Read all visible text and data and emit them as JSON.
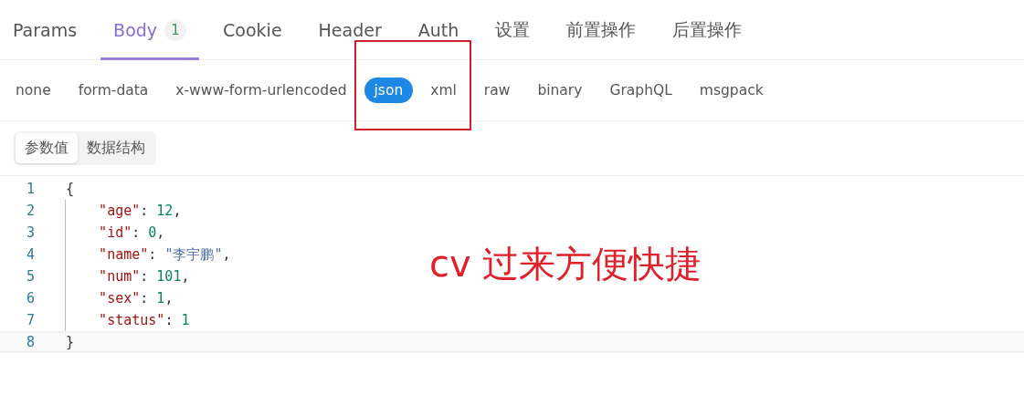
{
  "tabs": [
    {
      "label": "Params",
      "selected": false
    },
    {
      "label": "Body",
      "selected": true,
      "badge": "1"
    },
    {
      "label": "Cookie",
      "selected": false
    },
    {
      "label": "Header",
      "selected": false
    },
    {
      "label": "Auth",
      "selected": false
    },
    {
      "label": "设置",
      "selected": false
    },
    {
      "label": "前置操作",
      "selected": false
    },
    {
      "label": "后置操作",
      "selected": false
    }
  ],
  "body_types": [
    {
      "label": "none",
      "selected": false
    },
    {
      "label": "form-data",
      "selected": false
    },
    {
      "label": "x-www-form-urlencoded",
      "selected": false
    },
    {
      "label": "json",
      "selected": true
    },
    {
      "label": "xml",
      "selected": false
    },
    {
      "label": "raw",
      "selected": false
    },
    {
      "label": "binary",
      "selected": false
    },
    {
      "label": "GraphQL",
      "selected": false
    },
    {
      "label": "msgpack",
      "selected": false
    }
  ],
  "view_toggle": [
    {
      "label": "参数值",
      "selected": true
    },
    {
      "label": "数据结构",
      "selected": false
    }
  ],
  "editor": {
    "lines": [
      {
        "number": "1",
        "active": false,
        "guide": false,
        "tokens": [
          {
            "kind": "punct",
            "text": "{"
          }
        ]
      },
      {
        "number": "2",
        "active": false,
        "guide": true,
        "tokens": [
          {
            "kind": "key",
            "text": "    \"age\""
          },
          {
            "kind": "punct",
            "text": ": "
          },
          {
            "kind": "number",
            "text": "12"
          },
          {
            "kind": "punct",
            "text": ","
          }
        ]
      },
      {
        "number": "3",
        "active": false,
        "guide": true,
        "tokens": [
          {
            "kind": "key",
            "text": "    \"id\""
          },
          {
            "kind": "punct",
            "text": ": "
          },
          {
            "kind": "number",
            "text": "0"
          },
          {
            "kind": "punct",
            "text": ","
          }
        ]
      },
      {
        "number": "4",
        "active": false,
        "guide": true,
        "tokens": [
          {
            "kind": "key",
            "text": "    \"name\""
          },
          {
            "kind": "punct",
            "text": ": "
          },
          {
            "kind": "string",
            "text": "\"李宇鹏\""
          },
          {
            "kind": "punct",
            "text": ","
          }
        ]
      },
      {
        "number": "5",
        "active": false,
        "guide": true,
        "tokens": [
          {
            "kind": "key",
            "text": "    \"num\""
          },
          {
            "kind": "punct",
            "text": ": "
          },
          {
            "kind": "number",
            "text": "101"
          },
          {
            "kind": "punct",
            "text": ","
          }
        ]
      },
      {
        "number": "6",
        "active": false,
        "guide": true,
        "tokens": [
          {
            "kind": "key",
            "text": "    \"sex\""
          },
          {
            "kind": "punct",
            "text": ": "
          },
          {
            "kind": "number",
            "text": "1"
          },
          {
            "kind": "punct",
            "text": ","
          }
        ]
      },
      {
        "number": "7",
        "active": false,
        "guide": true,
        "tokens": [
          {
            "kind": "key",
            "text": "    \"status\""
          },
          {
            "kind": "punct",
            "text": ": "
          },
          {
            "kind": "number",
            "text": "1"
          }
        ]
      },
      {
        "number": "8",
        "active": true,
        "guide": false,
        "tokens": [
          {
            "kind": "punct",
            "text": "}"
          }
        ]
      }
    ]
  },
  "annotation": {
    "text": "cv 过来方便快捷"
  }
}
